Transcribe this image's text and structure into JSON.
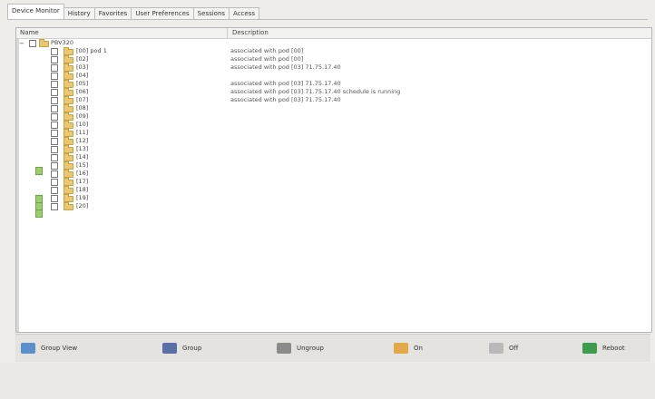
{
  "tabs": [
    {
      "label": "Device Monitor",
      "active": true
    },
    {
      "label": "History",
      "active": false
    },
    {
      "label": "Favorites",
      "active": false
    },
    {
      "label": "User Preferences",
      "active": false
    },
    {
      "label": "Sessions",
      "active": false
    },
    {
      "label": "Access",
      "active": false
    }
  ],
  "columns": {
    "name": "Name",
    "description": "Description"
  },
  "tree": {
    "root": {
      "label": "PBV320"
    },
    "items": [
      {
        "label": "[00] pod 1",
        "description": "associated with pod [00]"
      },
      {
        "label": "[02]",
        "description": "associated with pod [00]"
      },
      {
        "label": "[03]",
        "description": "associated with pod [03] 71.75.17.40"
      },
      {
        "label": "[04]",
        "description": ""
      },
      {
        "label": "[05]",
        "description": "associated with pod [03] 71.75.17.40"
      },
      {
        "label": "[06]",
        "description": "associated with pod [03] 71.75.17.40 schedule is running"
      },
      {
        "label": "[07]",
        "description": "associated with pod [03] 71.75.17.40"
      },
      {
        "label": "[08]",
        "description": ""
      },
      {
        "label": "[09]",
        "description": ""
      },
      {
        "label": "[10]",
        "description": ""
      },
      {
        "label": "[11]",
        "description": ""
      },
      {
        "label": "[12]",
        "description": ""
      },
      {
        "label": "[13]",
        "description": ""
      },
      {
        "label": "[14]",
        "description": ""
      },
      {
        "label": "[15]",
        "description": ""
      },
      {
        "label": "[16]",
        "description": ""
      },
      {
        "label": "[17]",
        "description": ""
      },
      {
        "label": "[18]",
        "description": ""
      },
      {
        "label": "[19]",
        "description": ""
      },
      {
        "label": "[20]",
        "description": ""
      }
    ]
  },
  "toolbar": [
    {
      "label": "Group View",
      "icon": "group-view-icon",
      "color": "#5b8fc9"
    },
    {
      "label": "Group",
      "icon": "group-icon",
      "color": "#5a6fa8"
    },
    {
      "label": "Ungroup",
      "icon": "ungroup-icon",
      "color": "#8a8a8a"
    },
    {
      "label": "On",
      "icon": "power-on-icon",
      "color": "#e2a84a"
    },
    {
      "label": "Off",
      "icon": "power-off-icon",
      "color": "#b9b9b9"
    },
    {
      "label": "Reboot",
      "icon": "reboot-icon",
      "color": "#3f9b4d"
    }
  ],
  "colors": {
    "folder": "#e8c872",
    "marker": "#9acd6b",
    "panel_bg": "#ffffff",
    "window_bg": "#eeedea"
  }
}
